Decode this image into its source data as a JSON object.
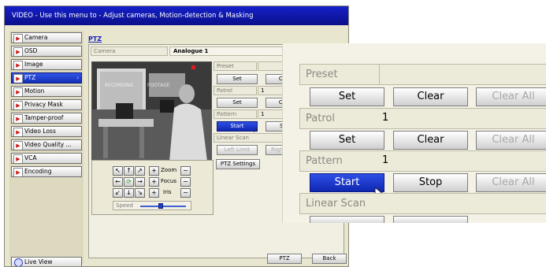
{
  "window": {
    "title": "VIDEO - Use this menu to - Adjust cameras, Motion-detection & Masking"
  },
  "sidebar": {
    "items": [
      {
        "label": "Camera"
      },
      {
        "label": "OSD"
      },
      {
        "label": "Image"
      },
      {
        "label": "PTZ",
        "active": true
      },
      {
        "label": "Motion"
      },
      {
        "label": "Privacy Mask"
      },
      {
        "label": "Tamper-proof"
      },
      {
        "label": "Video Loss"
      },
      {
        "label": "Video Quality ..."
      },
      {
        "label": "VCA"
      },
      {
        "label": "Encoding"
      }
    ],
    "live_view": "Live View"
  },
  "page": {
    "heading": "PTZ",
    "camera_label": "Camera",
    "camera_value": "Analogue 1"
  },
  "camera_overlay": {
    "left_text": "RECORDING",
    "right_text": "FOOTAGE"
  },
  "preset": {
    "label": "Preset",
    "set": "Set",
    "clear": "Clear"
  },
  "patrol": {
    "label": "Patrol",
    "value": "1",
    "set": "Set",
    "clear": "Clear"
  },
  "pattern": {
    "label": "Pattern",
    "value": "1",
    "start": "Start",
    "stop": "Stop"
  },
  "linear_scan": {
    "label": "Linear Scan",
    "left_limit": "Left Limit",
    "right_limit": "Right Limit"
  },
  "ptz_settings": "PTZ Settings",
  "pad": {
    "zoom": "Zoom",
    "focus": "Focus",
    "iris": "Iris",
    "speed": "Speed",
    "speed_level": 0.45
  },
  "footer": {
    "ptz": "PTZ",
    "back": "Back"
  },
  "zoom_panel": {
    "preset_label": "Preset",
    "set": "Set",
    "clear": "Clear",
    "clear_all": "Clear All",
    "patrol_label": "Patrol",
    "patrol_value": "1",
    "patrol_set": "Set",
    "patrol_clear": "Clear",
    "patrol_clear_all": "Clear All",
    "pattern_label": "Pattern",
    "pattern_value": "1",
    "start": "Start",
    "stop": "Stop",
    "pattern_clear_all": "Clear All",
    "linear_scan_label": "Linear Scan"
  },
  "colors": {
    "title_bar": "#1520c8",
    "active_blue": "#1f3fd6",
    "panel_beige": "#e9e6cf",
    "arrow_red": "#d41414"
  }
}
